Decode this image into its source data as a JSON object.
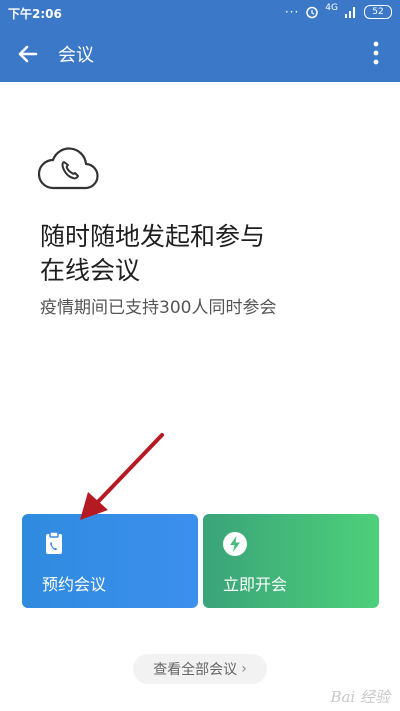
{
  "status_bar": {
    "time": "下午2:06",
    "network": "4G",
    "battery": "52"
  },
  "app_bar": {
    "title": "会议"
  },
  "hero": {
    "headline": "随时随地发起和参与\n在线会议",
    "subline": "疫情期间已支持300人同时参会"
  },
  "actions": [
    {
      "label": "预约会议",
      "icon": "calendar-clipboard-icon",
      "color": "#3d8fee"
    },
    {
      "label": "立即开会",
      "icon": "lightning-icon",
      "color": "#4ed07a"
    }
  ],
  "view_all": {
    "label": "查看全部会议"
  },
  "watermark": {
    "text": "Bai 经验"
  },
  "colors": {
    "primary": "#3c78c8",
    "annotation_arrow": "#b51a22"
  }
}
